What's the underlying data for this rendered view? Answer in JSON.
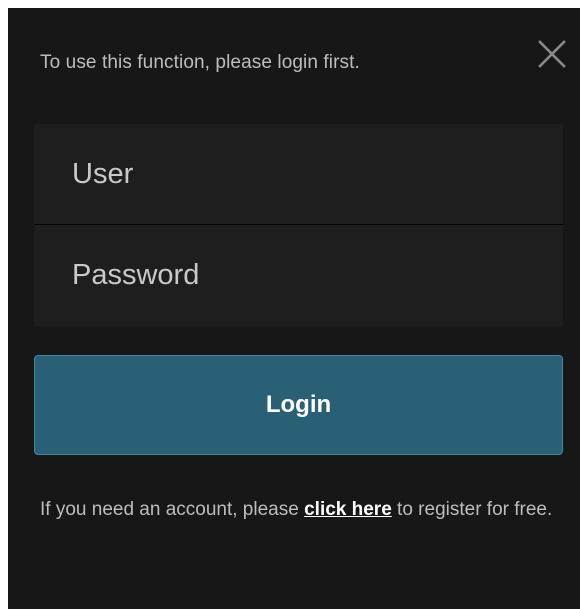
{
  "dialog": {
    "message": "To use this function, please login first.",
    "close_icon": "close-icon"
  },
  "form": {
    "user_placeholder": "User",
    "user_value": "",
    "password_placeholder": "Password",
    "password_value": "",
    "login_label": "Login"
  },
  "register": {
    "prefix": "If you need an account, please ",
    "link_text": "click here",
    "suffix": " to register for free."
  },
  "colors": {
    "background": "#171717",
    "field_bg": "#1e1e1f",
    "button_bg": "#2a6075",
    "button_border": "#3e88a3",
    "text_muted": "#bdbdbd",
    "text_light": "#ffffff"
  }
}
